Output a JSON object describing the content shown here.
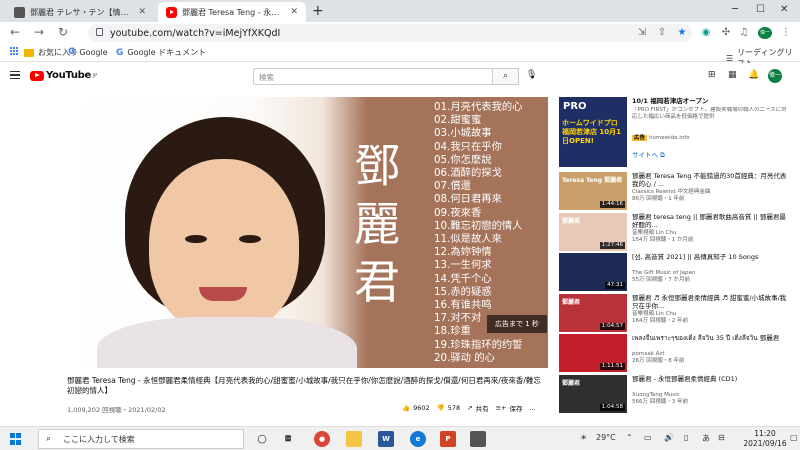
{
  "browser": {
    "tabs": [
      {
        "title": "鄧麗君 テレサ・テン【情選】歌詞...",
        "active": false
      },
      {
        "title": "鄧麗君 Teresa Teng - 永恒鄧麗君...",
        "active": true
      }
    ],
    "new_tab": "+",
    "url": "youtube.com/watch?v=iMejYfXKQdI",
    "bookmarks": {
      "apps": "",
      "favorites": "お気に入り",
      "google": "Google",
      "docs": "Google ドキュメント",
      "reading_list": "リーディングリスト"
    },
    "profile_initial": "偉一"
  },
  "youtube": {
    "logo_text": "YouTube",
    "logo_region": "JP",
    "search_placeholder": "検索",
    "avatar_initial": "偉一",
    "video": {
      "big_name": "鄧麗君",
      "songs": [
        "01.月亮代表我的心",
        "02.甜蜜蜜",
        "03.小城故事",
        "04.我只在乎你",
        "05.你怎麽說",
        "06.酒醉的探戈",
        "07.償還",
        "08.何日君再來",
        "09.夜來香",
        "10.難忘初戀的情人",
        "11.似是故人來",
        "12.為妳钟情",
        "13.一生何求",
        "14.凭千个心",
        "15.赤的疑惑",
        "16.有谁共鸣",
        "17.对不对",
        "18.珍重",
        "19.珍珠指环的约誓",
        "20.驿动 的心"
      ],
      "ad_text": "広告まで 1 秒",
      "title": "鄧麗君 Teresa Teng - 永恒鄧麗君柔情經典【月亮代表我的心/甜蜜蜜/小城故事/我只在乎你/你怎麽說/酒醉的探戈/償還/何日君再來/夜來香/難忘初戀的情人】",
      "meta": "1,009,202 回視聴・2021/02/02",
      "likes": "9602",
      "dislikes": "578",
      "share": "共有",
      "save": "保存",
      "more": "..."
    },
    "sidebar": [
      {
        "title": "10/1 福岡若津店オープン",
        "desc": "「PRO FIRST」がコンセプト。建設実職場の職人のニーズに対応した幅広い商品を低価格で提供",
        "ad_label": "広告",
        "domain": "homewide.info",
        "cta": "サイトへ",
        "thumb_text": "ホームワイドプロ 福岡若津店 10月1日OPEN!"
      },
      {
        "title": "鄧麗君 Teresa Teng 不能錯過的30首經典：月亮代表我的心 / ...",
        "channel": "Classics Rewind 中文經典金曲",
        "meta": "86万 回視聴・1 年前",
        "duration": "1:44:16",
        "thumb_text": "Teresa Teng 鄧麗君"
      },
      {
        "title": "鄧麗君 teresa teng || 鄧麗君歌曲高音質 || 鄧麗君最好聽的...",
        "channel": "音樂視頻 Lin Chu",
        "meta": "154万 回視聴・1 か月前",
        "duration": "1:27:46",
        "thumb_text": "鄧麗君"
      },
      {
        "title": "[섬, 高音質 2021] || 高傳真知子 10 Songs",
        "channel": "The Gift Music of Japan",
        "meta": "55万 回視聴・7 か月前",
        "duration": "47:31",
        "thumb_text": ""
      },
      {
        "title": "鄧麗君 ♬ 永恒鄧麗君柔情經典 ♬ 甜蜜蜜/小城故事/我只在乎你...",
        "channel": "音樂視頻 Lin Chu",
        "meta": "164万 回視聴・2 年前",
        "duration": "1:04:57",
        "thumb_text": "鄧麗君"
      },
      {
        "title": "เพลงจีนเพราะๆของเติ้ง ลี่จวิน 35 ปี เติ้งลี่จวิน 鄧麗君",
        "channel": "pornsak Azt",
        "meta": "26万 回視聴・8 年前",
        "duration": "1:11:51",
        "thumb_text": ""
      },
      {
        "title": "鄧麗君 - 永恒鄧麗君柔情經典 (CD1)",
        "channel": "XuongTang Music",
        "meta": "566万 回視聴・3 年前",
        "duration": "1:04:58",
        "thumb_text": "鄧麗君"
      }
    ]
  },
  "taskbar": {
    "search_placeholder": "ここに入力して検索",
    "weather": "29°C",
    "ime": "あ",
    "time": "11:20",
    "date": "2021/09/16"
  }
}
